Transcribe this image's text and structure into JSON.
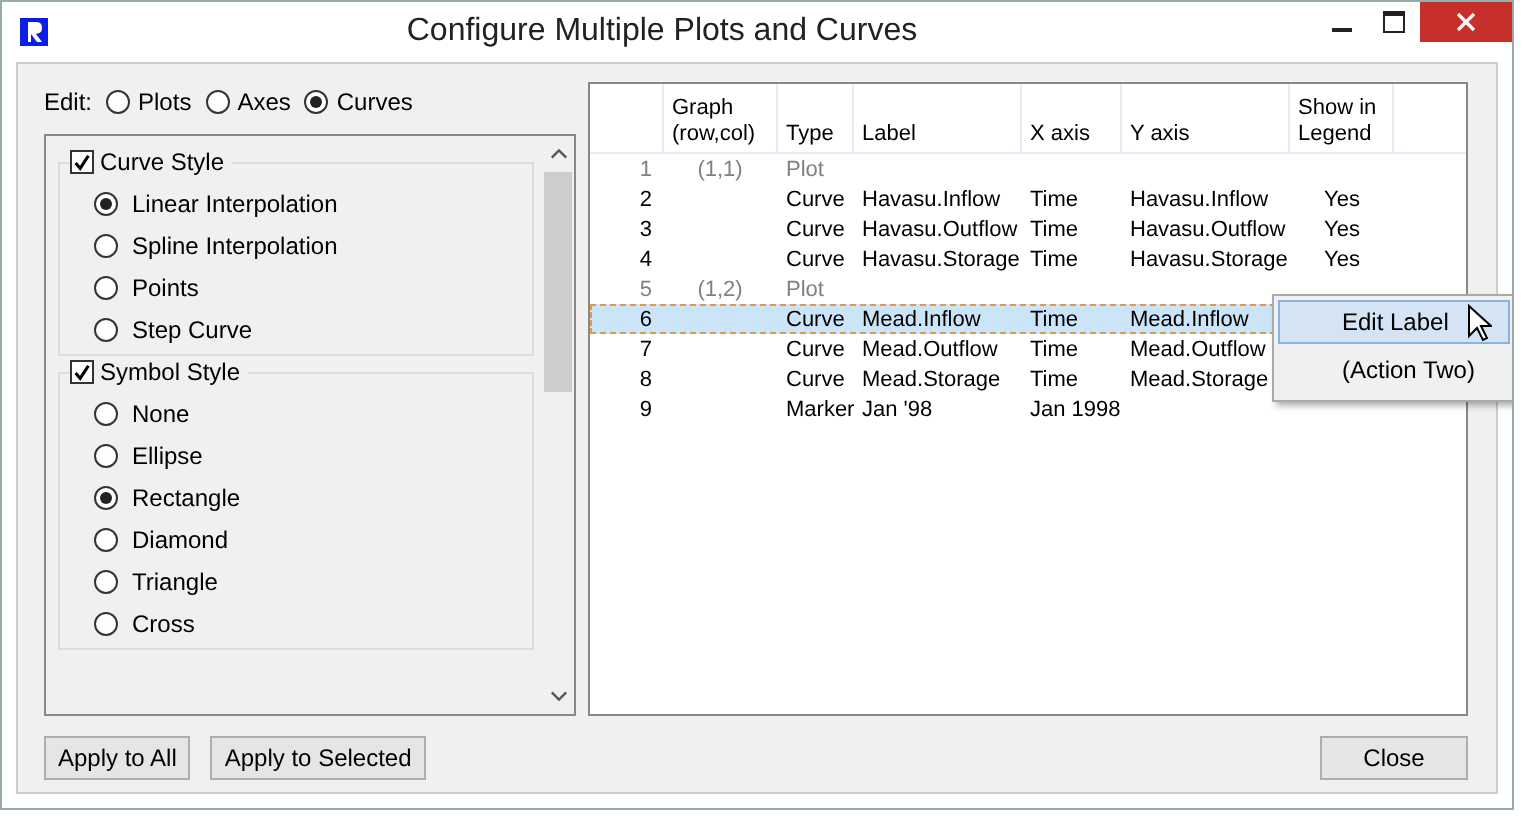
{
  "window": {
    "title": "Configure Multiple Plots and Curves"
  },
  "edit_mode": {
    "label": "Edit:",
    "options": [
      {
        "label": "Plots",
        "selected": false
      },
      {
        "label": "Axes",
        "selected": false
      },
      {
        "label": "Curves",
        "selected": true
      }
    ]
  },
  "groups": [
    {
      "title": "Curve Style",
      "checked": true,
      "options": [
        {
          "label": "Linear Interpolation",
          "selected": true
        },
        {
          "label": "Spline Interpolation",
          "selected": false
        },
        {
          "label": "Points",
          "selected": false
        },
        {
          "label": "Step Curve",
          "selected": false
        }
      ]
    },
    {
      "title": "Symbol Style",
      "checked": true,
      "options": [
        {
          "label": "None",
          "selected": false
        },
        {
          "label": "Ellipse",
          "selected": false
        },
        {
          "label": "Rectangle",
          "selected": true
        },
        {
          "label": "Diamond",
          "selected": false
        },
        {
          "label": "Triangle",
          "selected": false
        },
        {
          "label": "Cross",
          "selected": false
        }
      ]
    }
  ],
  "table": {
    "columns": [
      "",
      "Graph (row,col)",
      "Type",
      "Label",
      "X axis",
      "Y axis",
      "Show in Legend"
    ],
    "rows": [
      {
        "kind": "plot",
        "selected": false,
        "cells": [
          "1",
          "(1,1)",
          "Plot",
          "",
          "",
          "",
          ""
        ]
      },
      {
        "kind": "curve",
        "selected": false,
        "cells": [
          "2",
          "",
          "Curve",
          "Havasu.Inflow",
          "Time",
          "Havasu.Inflow",
          "Yes"
        ]
      },
      {
        "kind": "curve",
        "selected": false,
        "cells": [
          "3",
          "",
          "Curve",
          "Havasu.Outflow",
          "Time",
          "Havasu.Outflow",
          "Yes"
        ]
      },
      {
        "kind": "curve",
        "selected": false,
        "cells": [
          "4",
          "",
          "Curve",
          "Havasu.Storage",
          "Time",
          "Havasu.Storage",
          "Yes"
        ]
      },
      {
        "kind": "plot",
        "selected": false,
        "cells": [
          "5",
          "(1,2)",
          "Plot",
          "",
          "",
          "",
          ""
        ]
      },
      {
        "kind": "curve",
        "selected": true,
        "cells": [
          "6",
          "",
          "Curve",
          "Mead.Inflow",
          "Time",
          "Mead.Inflow",
          ""
        ]
      },
      {
        "kind": "curve",
        "selected": false,
        "cells": [
          "7",
          "",
          "Curve",
          "Mead.Outflow",
          "Time",
          "Mead.Outflow",
          ""
        ]
      },
      {
        "kind": "curve",
        "selected": false,
        "cells": [
          "8",
          "",
          "Curve",
          "Mead.Storage",
          "Time",
          "Mead.Storage",
          ""
        ]
      },
      {
        "kind": "marker",
        "selected": false,
        "cells": [
          "9",
          "",
          "Marker",
          "Jan '98",
          "Jan 1998",
          "",
          ""
        ]
      }
    ]
  },
  "context_menu": {
    "items": [
      {
        "label": "Edit Label",
        "selected": true
      },
      {
        "label": "(Action Two)",
        "selected": false
      }
    ]
  },
  "buttons": [
    "Apply to All",
    "Apply to Selected"
  ],
  "close_button": "Close"
}
